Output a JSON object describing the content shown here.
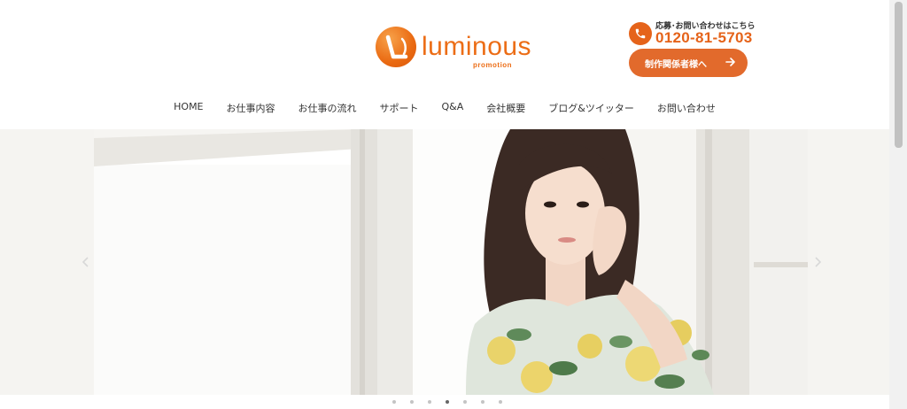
{
  "brand": {
    "name": "luminous",
    "tagline": "promotion",
    "color": "#ec6d16"
  },
  "contact": {
    "label": "応募･お問い合わせはこちら",
    "phone": "0120-81-5703",
    "icon": "phone-icon"
  },
  "cta": {
    "label": "制作関係者様へ",
    "icon": "arrow-right-icon",
    "color": "#e26a2c"
  },
  "nav": {
    "items": [
      "HOME",
      "お仕事内容",
      "お仕事の流れ",
      "サポート",
      "Q&A",
      "会社概要",
      "ブログ&ツイッター",
      "お問い合わせ"
    ]
  },
  "slider": {
    "slide_count": 7,
    "active_index": 3,
    "prev_icon": "chevron-left-icon",
    "next_icon": "chevron-right-icon"
  }
}
